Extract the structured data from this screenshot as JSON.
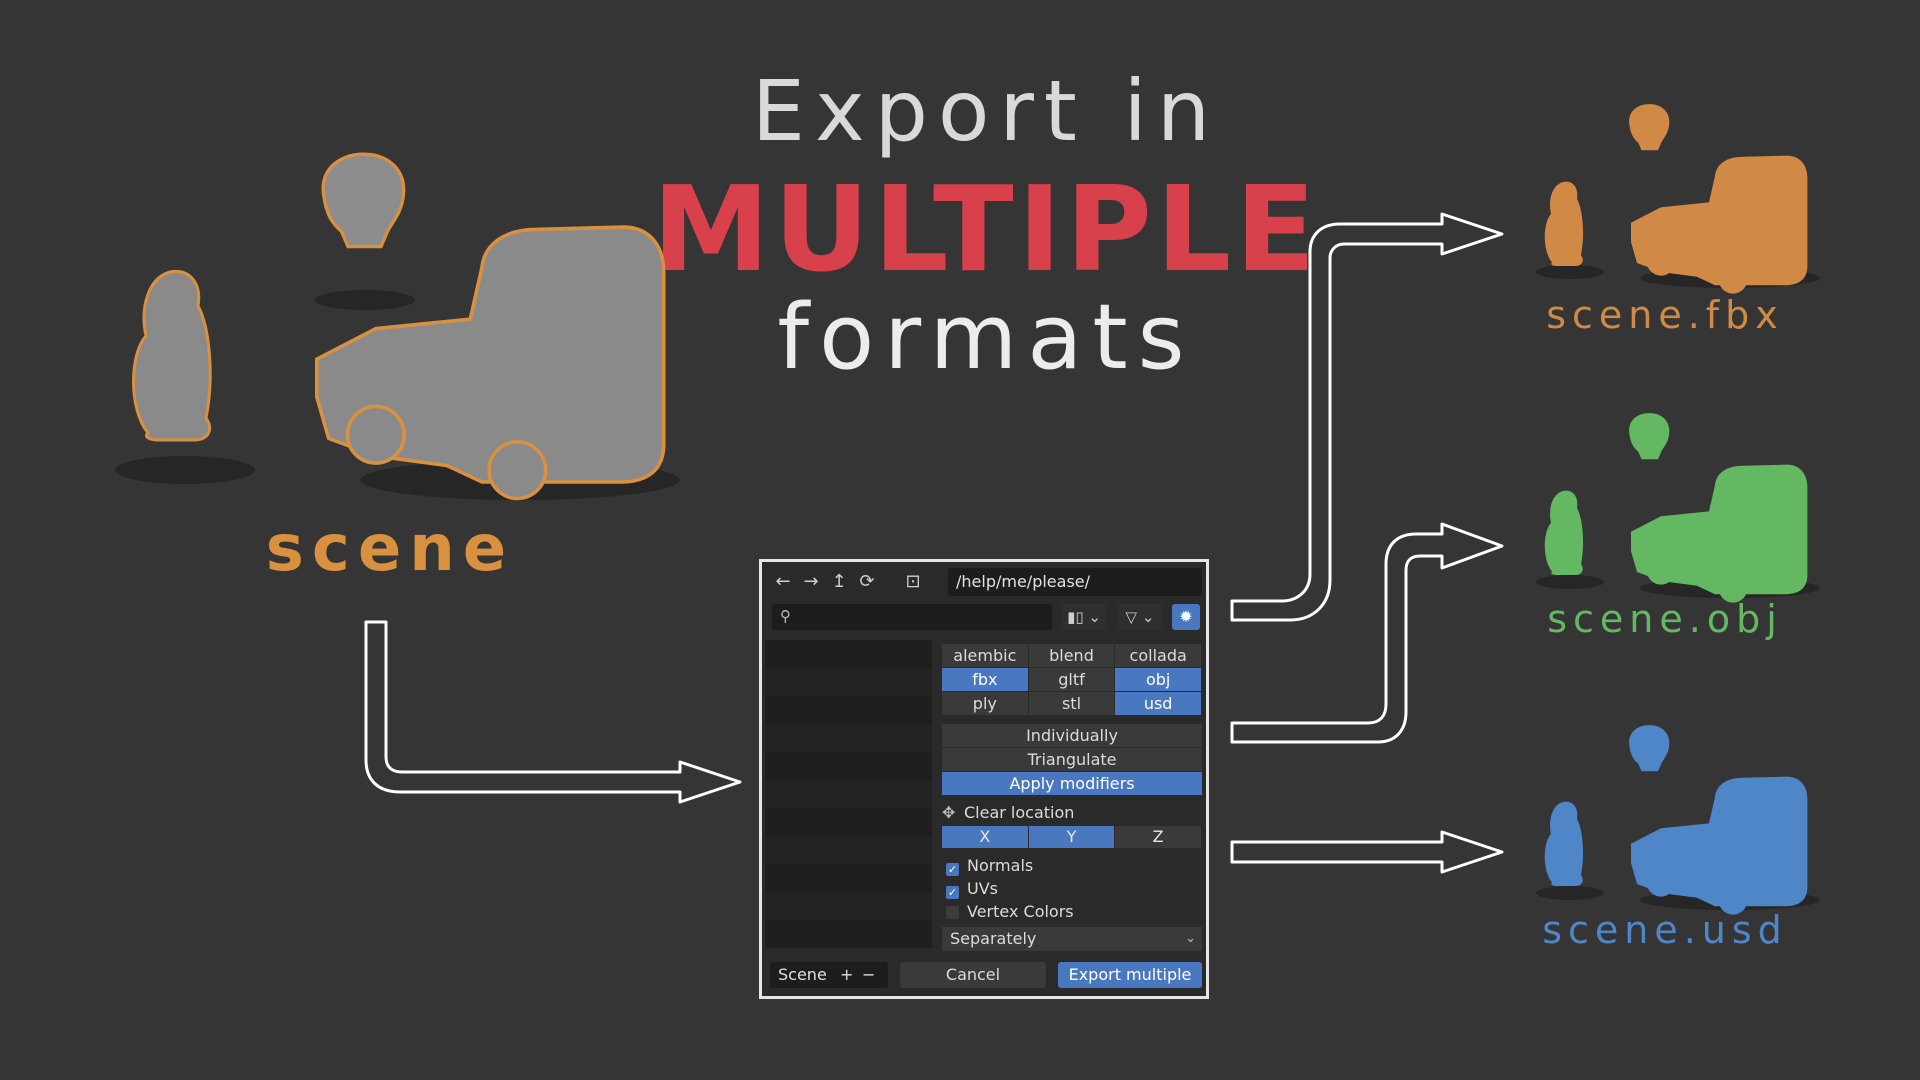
{
  "title": {
    "line1": "Export in",
    "line2": "MULTIPLE",
    "line3": "formats"
  },
  "scene_label": "scene",
  "outputs": [
    {
      "label": "scene.fbx",
      "color": "#d18a45"
    },
    {
      "label": "scene.obj",
      "color": "#64b862"
    },
    {
      "label": "scene.usd",
      "color": "#4f86c8"
    }
  ],
  "dialog": {
    "path": "/help/me/please/",
    "formats": [
      {
        "label": "alembic",
        "on": false
      },
      {
        "label": "blend",
        "on": false
      },
      {
        "label": "collada",
        "on": false
      },
      {
        "label": "fbx",
        "on": true
      },
      {
        "label": "gltf",
        "on": false
      },
      {
        "label": "obj",
        "on": true
      },
      {
        "label": "ply",
        "on": false
      },
      {
        "label": "stl",
        "on": false
      },
      {
        "label": "usd",
        "on": true
      }
    ],
    "options": {
      "individually": "Individually",
      "triangulate": "Triangulate",
      "apply_modifiers": "Apply modifiers"
    },
    "clear_location": "Clear location",
    "axes": {
      "x": "X",
      "y": "Y",
      "z": "Z"
    },
    "checks": {
      "normals": "Normals",
      "uvs": "UVs",
      "vertex_colors": "Vertex Colors"
    },
    "mode": "Separately",
    "scene_control": "Scene",
    "cancel": "Cancel",
    "export": "Export multiple"
  },
  "colors": {
    "accent": "#4a78c0",
    "title_red": "#d8414b",
    "scene_orange": "#d9913f"
  }
}
